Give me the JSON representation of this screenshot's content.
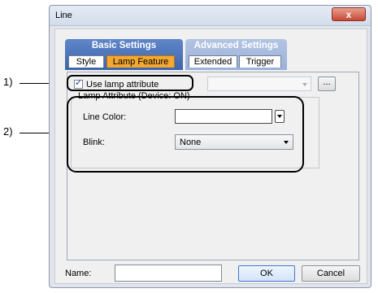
{
  "window": {
    "title": "Line",
    "close_symbol": "x"
  },
  "tab_groups": [
    {
      "label": "Basic Settings",
      "tabs": [
        "Style",
        "Lamp Feature"
      ],
      "active_tab": "Lamp Feature"
    },
    {
      "label": "Advanced Settings",
      "tabs": [
        "Extended",
        "Trigger"
      ]
    }
  ],
  "lamp": {
    "use_lamp_label": "Use lamp attribute",
    "use_lamp_checked": true,
    "device_combo_value": "",
    "browse_label": "..."
  },
  "lamp_attribute": {
    "group_title": "Lamp Attribute (Device: ON)",
    "line_color_label": "Line Color:",
    "line_color_value": "",
    "blink_label": "Blink:",
    "blink_value": "None"
  },
  "footer": {
    "name_label": "Name:",
    "name_value": "",
    "ok_label": "OK",
    "cancel_label": "Cancel"
  },
  "annotations": [
    "1)",
    "2)"
  ]
}
